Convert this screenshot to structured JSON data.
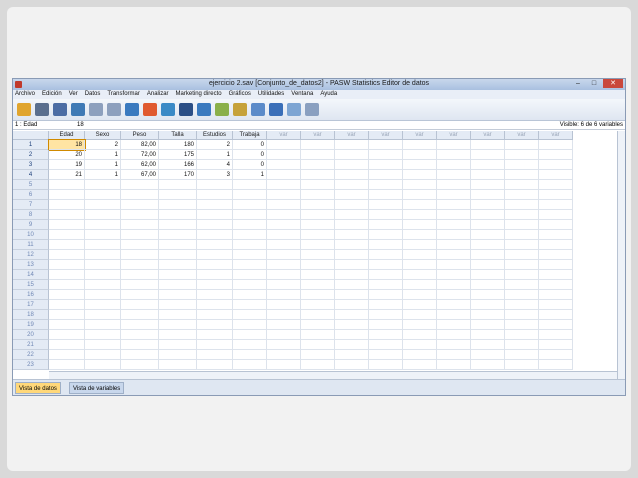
{
  "window": {
    "title": "ejercicio 2.sav [Conjunto_de_datos2] - PASW Statistics Editor de datos",
    "min_label": "–",
    "max_label": "□",
    "close_label": "✕"
  },
  "menu": [
    "Archivo",
    "Edición",
    "Ver",
    "Datos",
    "Transformar",
    "Analizar",
    "Marketing directo",
    "Gráficos",
    "Utilidades",
    "Ventana",
    "Ayuda"
  ],
  "cellbar": {
    "ref": "1 : Edad",
    "value": "18",
    "visible": "Visible: 6 de 6 variables"
  },
  "columns": [
    "Edad",
    "Sexo",
    "Peso",
    "Talla",
    "Estudios",
    "Trabaja",
    "var",
    "var",
    "var",
    "var",
    "var",
    "var",
    "var",
    "var",
    "var"
  ],
  "rows": [
    [
      "18",
      "2",
      "82,00",
      "180",
      "2",
      "0"
    ],
    [
      "20",
      "1",
      "72,00",
      "175",
      "1",
      "0"
    ],
    [
      "19",
      "1",
      "62,00",
      "166",
      "4",
      "0"
    ],
    [
      "21",
      "1",
      "67,00",
      "170",
      "3",
      "1"
    ]
  ],
  "row_numbers": [
    "1",
    "2",
    "3",
    "4",
    "5",
    "6",
    "7",
    "8",
    "9",
    "10",
    "11",
    "12",
    "13",
    "14",
    "15",
    "16",
    "17",
    "18",
    "19",
    "20",
    "21",
    "22",
    "23"
  ],
  "tabs": {
    "data_view": "Vista de datos",
    "variable_view": "Vista de variables"
  },
  "toolbar_icons": [
    "open-icon",
    "save-icon",
    "print-icon",
    "dialog-recall-icon",
    "undo-icon",
    "redo-icon",
    "goto-case-icon",
    "goto-variable-icon",
    "variables-icon",
    "find-icon",
    "insert-cases-icon",
    "split-file-icon",
    "weight-cases-icon",
    "select-cases-icon",
    "value-labels-icon",
    "use-sets-icon",
    "spell-icon"
  ]
}
